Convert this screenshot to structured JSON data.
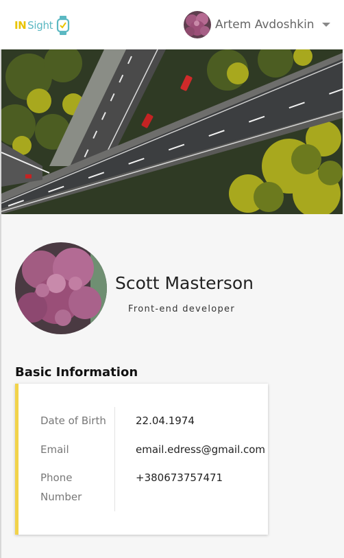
{
  "header": {
    "logo": {
      "part1": "IN",
      "part2": "Sight",
      "icon": "smartwatch-icon"
    },
    "user": {
      "name": "Artem Avdoshkin",
      "avatar_icon": "flower-avatar"
    },
    "menu_icon": "chevron-down-icon"
  },
  "hero": {
    "image": "highway-aerial-photo"
  },
  "profile": {
    "name": "Scott Masterson",
    "role": "Front-end developer",
    "avatar_icon": "flower-avatar"
  },
  "basic_info": {
    "title": "Basic Information",
    "rows": [
      {
        "label": "Date of Birth",
        "value": "22.04.1974"
      },
      {
        "label": "Email",
        "value": "email.edress@gmail.com"
      },
      {
        "label": "Phone Number",
        "value": "+380673757471"
      }
    ]
  },
  "colors": {
    "accent": "#f2d34a",
    "logo_in": "#e9c400",
    "logo_sight": "#5bb8c2",
    "text_primary": "#222222",
    "text_muted": "#777777"
  }
}
